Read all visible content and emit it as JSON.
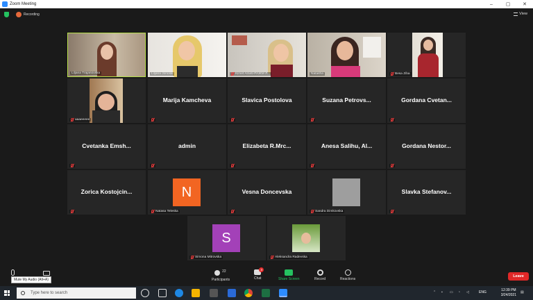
{
  "window": {
    "title": "Zoom Meeting",
    "controls": [
      "–",
      "▢",
      "✕"
    ]
  },
  "topbar": {
    "recording_label": "Recording",
    "view_label": "View"
  },
  "participants": [
    {
      "name": "Liljana Trajanovska",
      "display": "",
      "type": "video",
      "active": true
    },
    {
      "name": "Liljana Jonoski",
      "display": "",
      "type": "video"
    },
    {
      "name": "Kimet Ameti-РАЖМ Л...",
      "display": "",
      "type": "video"
    },
    {
      "name": "Natasha",
      "display": "",
      "type": "video"
    },
    {
      "name": "Besa Ziba",
      "display": "",
      "type": "video"
    },
    {
      "name": "aaaeeeee",
      "display": "",
      "type": "video"
    },
    {
      "name": "",
      "display": "Marija Kamcheva",
      "type": "name"
    },
    {
      "name": "",
      "display": "Slavica Postolova",
      "type": "name"
    },
    {
      "name": "",
      "display": "Suzana Petrovs...",
      "type": "name"
    },
    {
      "name": "",
      "display": "Gordana Cvetan...",
      "type": "name"
    },
    {
      "name": "",
      "display": "Cvetanka Emsh...",
      "type": "name"
    },
    {
      "name": "",
      "display": "admin",
      "type": "name"
    },
    {
      "name": "",
      "display": "Elizabeta R.Mrc...",
      "type": "name"
    },
    {
      "name": "",
      "display": "Anesa Salihu, Al...",
      "type": "name"
    },
    {
      "name": "",
      "display": "Gordana Nestor...",
      "type": "name"
    },
    {
      "name": "",
      "display": "Zorica Kostojcin...",
      "type": "name"
    },
    {
      "name": "Natasa Teleska",
      "display": "",
      "type": "avatar",
      "letter": "N",
      "color": "#f26522"
    },
    {
      "name": "",
      "display": "Vesna Doncevska",
      "type": "name"
    },
    {
      "name": "Sandra Dimkovska",
      "display": "",
      "type": "avatar",
      "letter": "",
      "color": "#9e9e9e"
    },
    {
      "name": "",
      "display": "Slavka Stefanov...",
      "type": "name"
    },
    {
      "name": "Simona Mitrovska",
      "display": "",
      "type": "avatar",
      "letter": "S",
      "color": "#a341b8"
    },
    {
      "name": "Aleksandra Radevska",
      "display": "",
      "type": "avatar",
      "letter": "",
      "color": "#6a9a3a"
    }
  ],
  "toolbar": {
    "mute_tooltip": "Mute My Audio (Alt+A)",
    "participants_label": "Participants",
    "participants_count": "22",
    "chat_label": "Chat",
    "chat_badge": "3",
    "share_label": "Share Screen",
    "record_label": "Record",
    "reactions_label": "Reactions",
    "leave_label": "Leave"
  },
  "taskbar": {
    "search_placeholder": "Type here to search",
    "lang": "ENG",
    "time": "12:39 PM",
    "date": "3/24/2021"
  },
  "colors": {
    "active_speaker": "#b7e04a",
    "share_green": "#25c260",
    "leave_red": "#e02828"
  }
}
